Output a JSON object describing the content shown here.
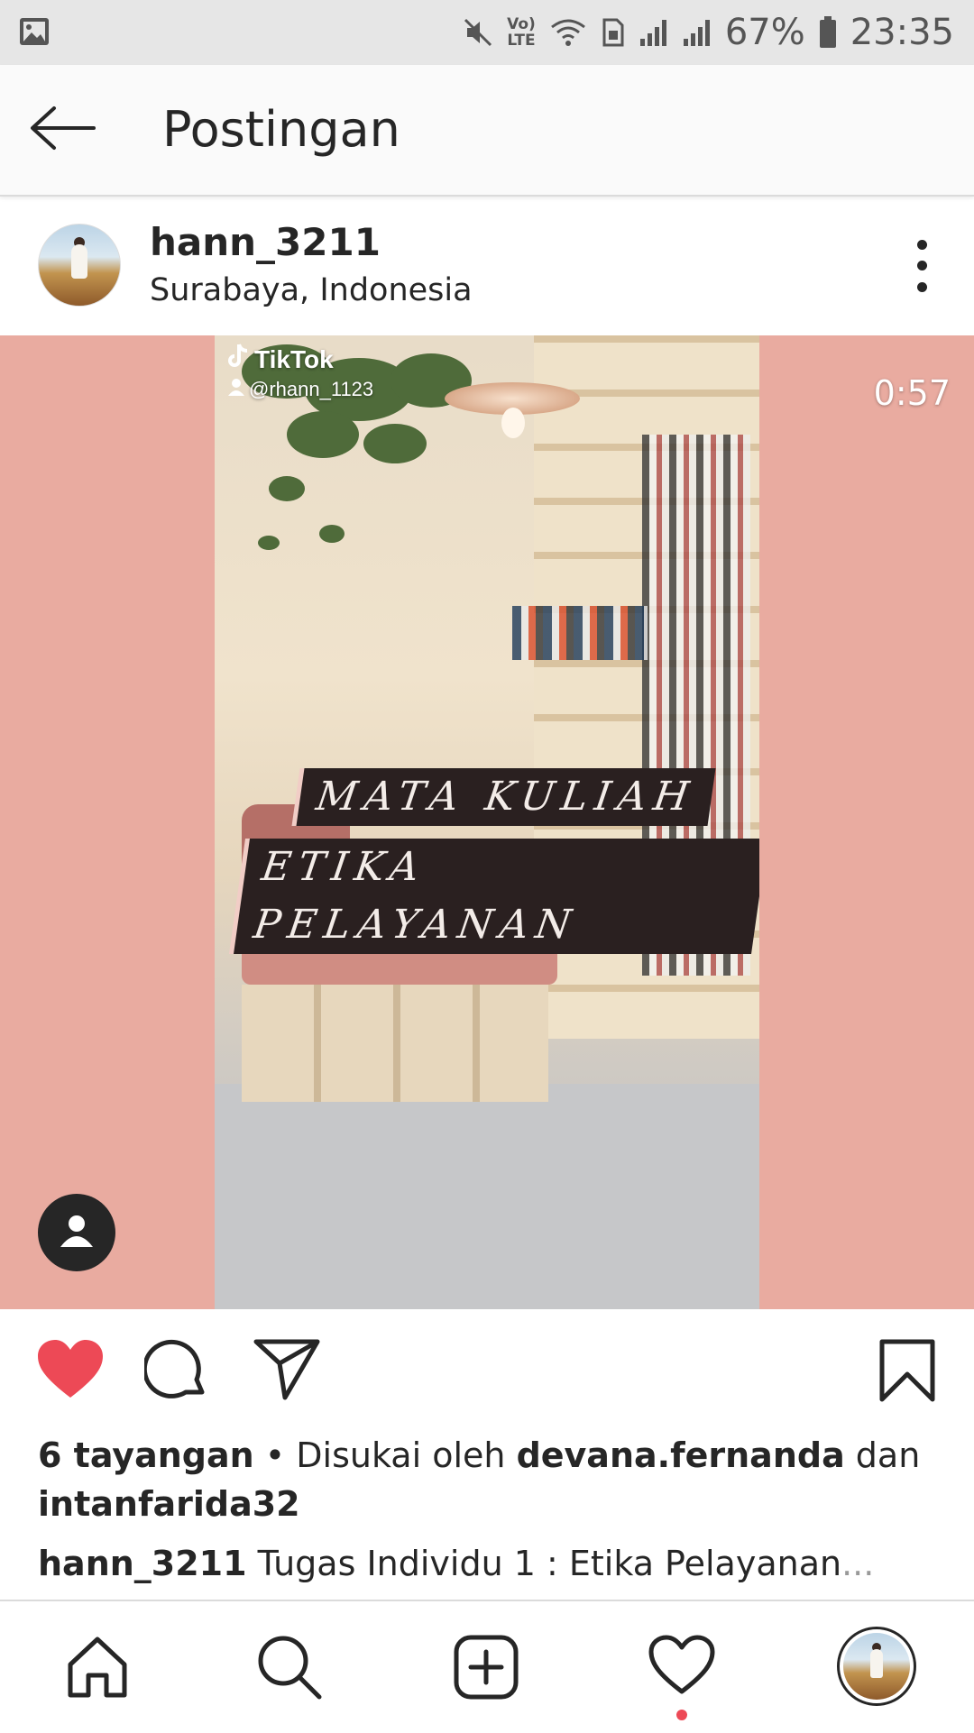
{
  "status_bar": {
    "battery": "67%",
    "time": "23:35",
    "network_label_top": "Vo)",
    "network_label_bottom": "LTE"
  },
  "app_bar": {
    "title": "Postingan"
  },
  "post": {
    "username": "hann_3211",
    "location": "Surabaya, Indonesia",
    "video": {
      "duration": "0:57",
      "watermark_brand": "TikTok",
      "watermark_handle": "@rhann_1123",
      "banner_line1": "MATA KULIAH",
      "banner_line2": "ETIKA PELAYANAN"
    },
    "liked": true,
    "views": "6 tayangan",
    "separator": " • ",
    "liked_by_prefix": "Disukai oleh ",
    "liked_by_user1": "devana.fernanda",
    "liked_by_joiner": " dan",
    "liked_by_user2": "intanfarida32",
    "caption_user": "hann_3211",
    "caption_text": " Tugas Individu 1 : Etika Pelayanan",
    "caption_more": "..."
  },
  "colors": {
    "media_background": "#e9aba0",
    "like_red": "#ed4956",
    "text": "#262626"
  },
  "icons": {
    "back": "arrow-left-icon",
    "more": "more-vertical-icon",
    "like": "heart-filled-icon",
    "comment": "comment-icon",
    "share": "send-icon",
    "save": "bookmark-icon",
    "tag_people": "person-icon",
    "nav": [
      "home-icon",
      "search-icon",
      "add-icon",
      "heart-icon",
      "profile-avatar"
    ]
  }
}
